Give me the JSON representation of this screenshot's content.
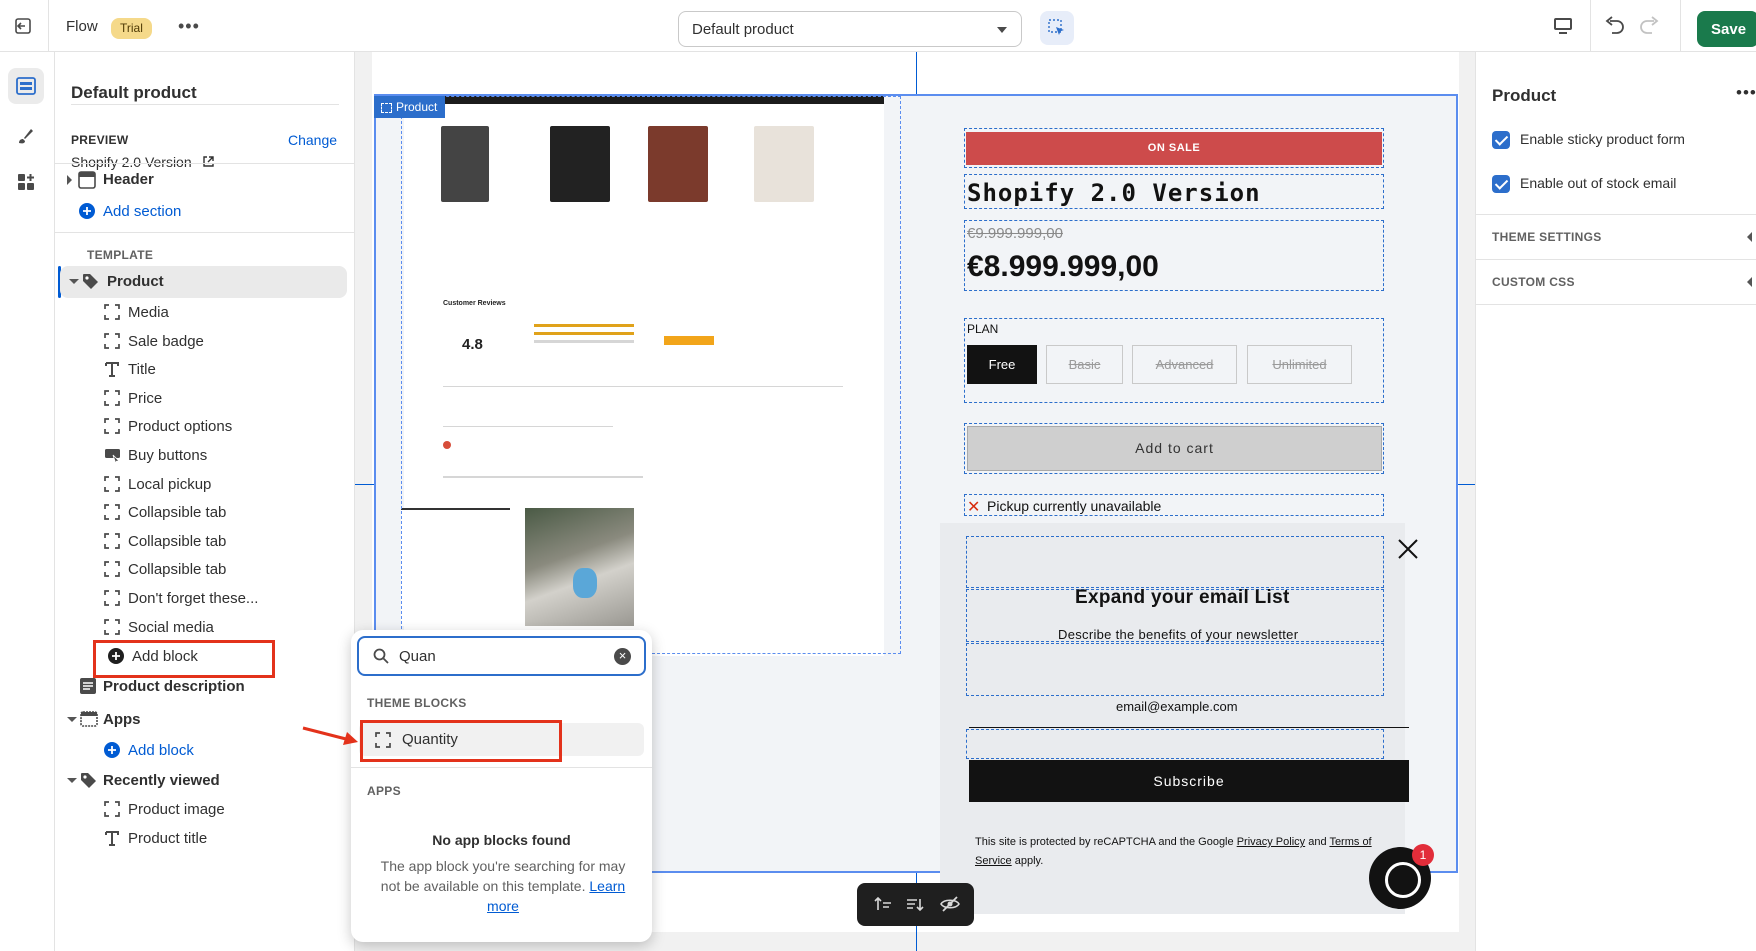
{
  "topbar": {
    "app_name": "Flow",
    "badge": "Trial",
    "more": "•••",
    "template_select": "Default product",
    "save_label": "Save"
  },
  "sidebar": {
    "title": "Default product",
    "preview_label": "PREVIEW",
    "change_label": "Change",
    "preview_value": "Shopify 2.0 Version",
    "header_label": "Header",
    "add_section_label": "Add section",
    "template_label": "TEMPLATE",
    "product_label": "Product",
    "blocks": [
      {
        "label": "Media",
        "icon": "dashed-square-icon"
      },
      {
        "label": "Sale badge",
        "icon": "dashed-square-icon"
      },
      {
        "label": "Title",
        "icon": "text-icon"
      },
      {
        "label": "Price",
        "icon": "dashed-square-icon"
      },
      {
        "label": "Product options",
        "icon": "dashed-square-icon"
      },
      {
        "label": "Buy buttons",
        "icon": "buy-button-icon"
      },
      {
        "label": "Local pickup",
        "icon": "dashed-square-icon"
      },
      {
        "label": "Collapsible tab",
        "icon": "dashed-square-icon"
      },
      {
        "label": "Collapsible tab",
        "icon": "dashed-square-icon"
      },
      {
        "label": "Collapsible tab",
        "icon": "dashed-square-icon"
      },
      {
        "label": "Don't forget these...",
        "icon": "dashed-square-icon"
      },
      {
        "label": "Social media",
        "icon": "dashed-square-icon"
      }
    ],
    "add_block_label": "Add block",
    "product_description_label": "Product description",
    "apps_label": "Apps",
    "apps_add_block_label": "Add block",
    "recently_viewed_label": "Recently viewed",
    "recently_blocks": [
      {
        "label": "Product image",
        "icon": "dashed-square-icon"
      },
      {
        "label": "Product title",
        "icon": "text-icon"
      }
    ]
  },
  "canvas": {
    "section_tag": "Product",
    "sale_badge": "ON SALE",
    "product_title": "Shopify 2.0 Version",
    "compare_price": "€9.999.999,00",
    "price": "€8.999.999,00",
    "plan_label": "PLAN",
    "plans": [
      "Free",
      "Basic",
      "Advanced",
      "Unlimited"
    ],
    "add_to_cart": "Add to cart",
    "pickup_text": "Pickup currently unavailable",
    "popup": {
      "title": "Expand your email List",
      "description": "Describe the benefits of your newsletter",
      "email_placeholder": "email@example.com",
      "subscribe": "Subscribe",
      "recaptcha_prefix": "This site is protected by reCAPTCHA and the Google ",
      "privacy_policy": "Privacy Policy",
      "and": " and ",
      "terms": "Terms of Service",
      "suffix": " apply."
    },
    "chat_badge_count": "1",
    "media_preview": {
      "reviews_title": "Customer Reviews",
      "rating": "4.8"
    }
  },
  "popover": {
    "search_value": "Quan",
    "theme_blocks_label": "THEME BLOCKS",
    "result_label": "Quantity",
    "apps_label": "APPS",
    "no_apps_title": "No app blocks found",
    "no_apps_desc": "The app block you're searching for may not be available on this template. ",
    "learn_more": "Learn more"
  },
  "rightpanel": {
    "title": "Product",
    "more": "•••",
    "checkboxes": [
      {
        "label": "Enable sticky product form",
        "checked": true
      },
      {
        "label": "Enable out of stock email",
        "checked": true
      }
    ],
    "theme_settings_label": "THEME SETTINGS",
    "custom_css_label": "CUSTOM CSS"
  },
  "colors": {
    "accent": "#005bd3",
    "save": "#1a7a4c",
    "trial_badge": "#f5d98a",
    "sale_badge": "#cd4b4b",
    "annotation": "#e3321b"
  }
}
